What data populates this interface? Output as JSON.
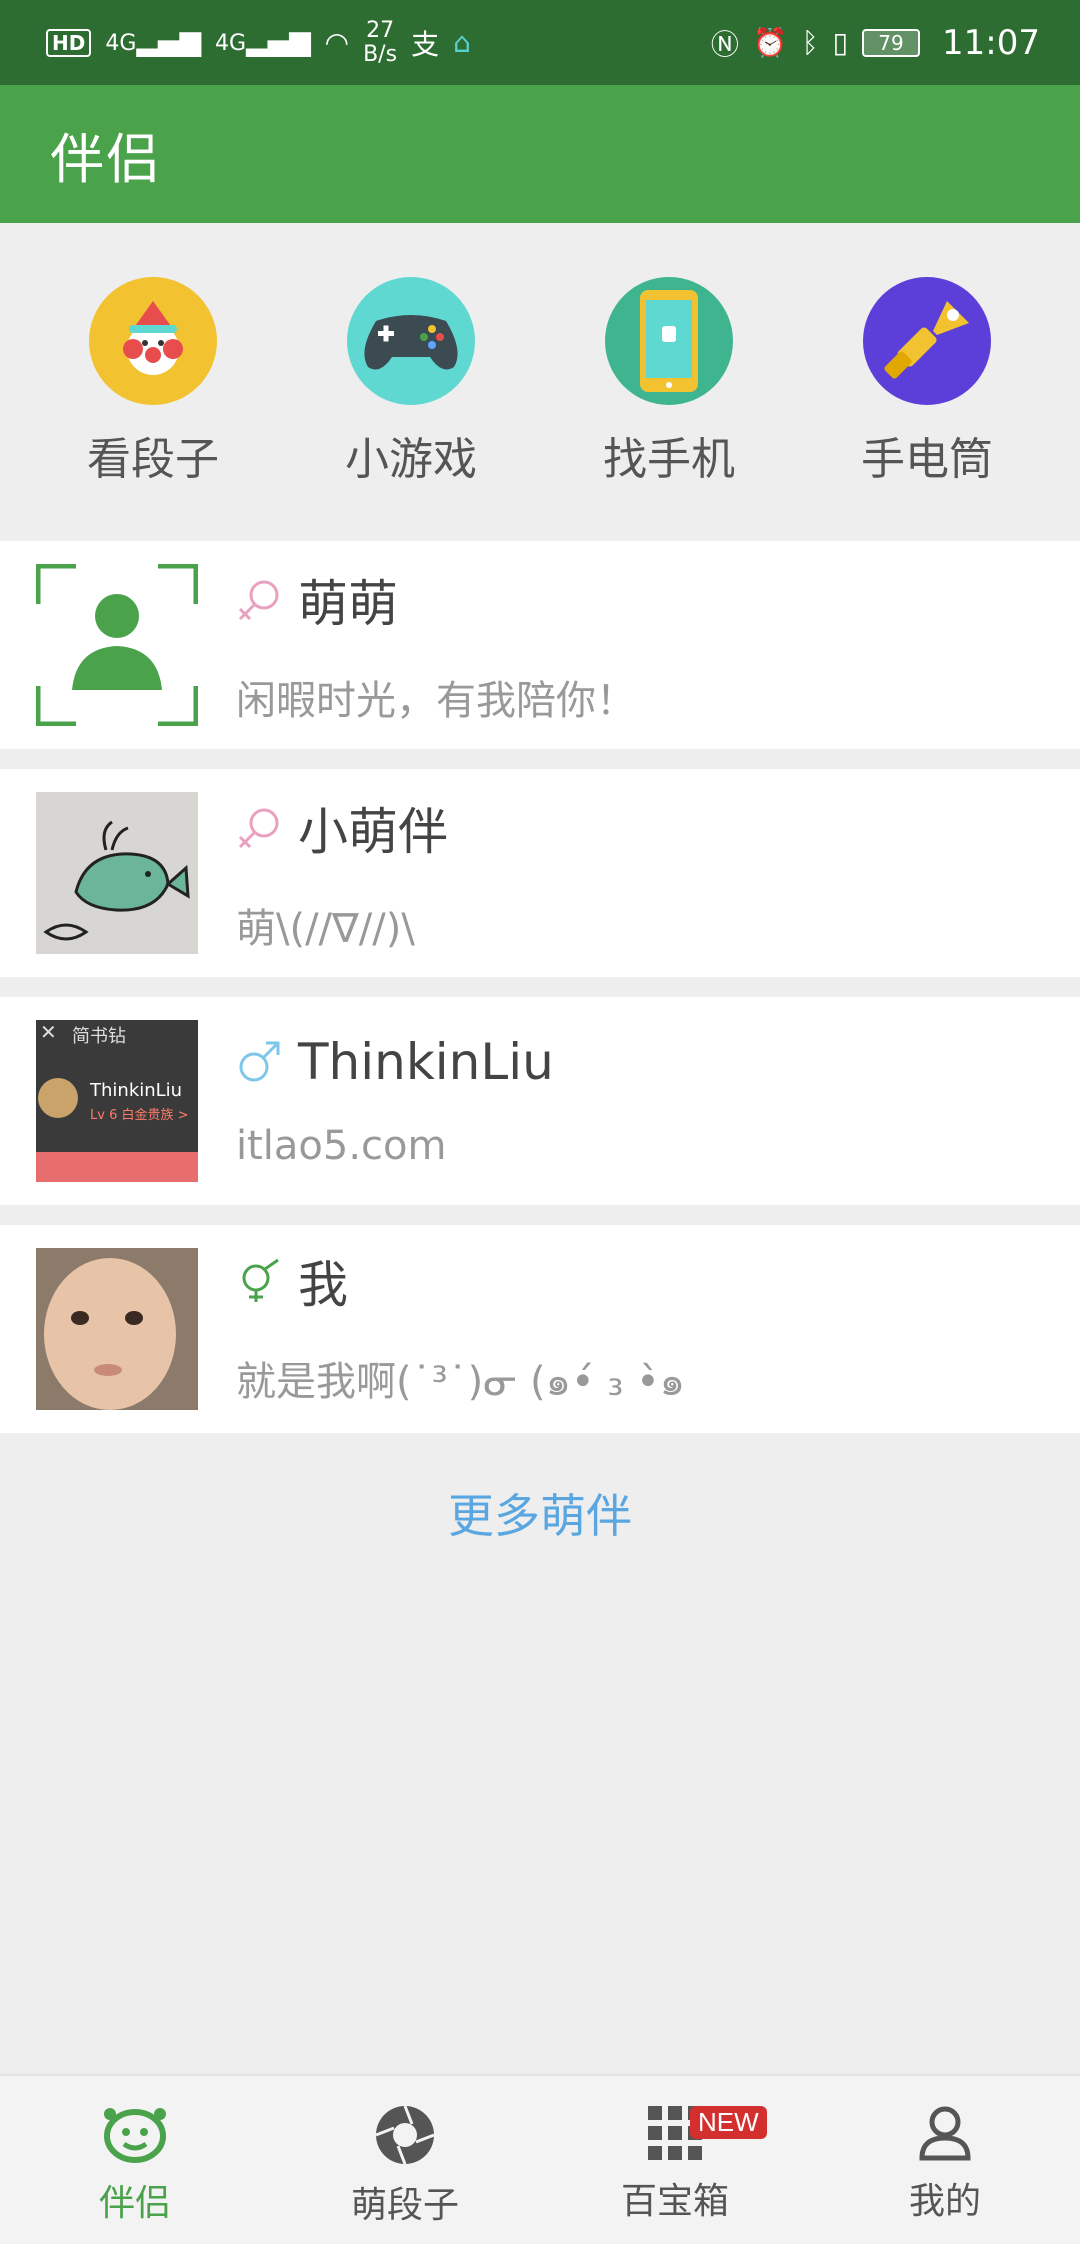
{
  "status_bar": {
    "left": {
      "hd": "HD",
      "net1": "4G",
      "net2": "4G",
      "speed": "27",
      "speed_unit": "B/s"
    },
    "right": {
      "battery": "79",
      "time": "11:07"
    }
  },
  "app_bar": {
    "title": "伴侣"
  },
  "quick_actions": [
    {
      "label": "看段子",
      "icon": "clown-icon",
      "color": "#f2c230"
    },
    {
      "label": "小游戏",
      "icon": "gamepad-icon",
      "color": "#5ed8d0"
    },
    {
      "label": "找手机",
      "icon": "phone-icon",
      "color": "#3fb58f"
    },
    {
      "label": "手电筒",
      "icon": "flashlight-icon",
      "color": "#5b3fd8"
    }
  ],
  "companions": [
    {
      "name": "萌萌",
      "desc": "闲暇时光，有我陪你！",
      "gender": "female",
      "avatar": "placeholder-avatar"
    },
    {
      "name": "小萌伴",
      "desc": "萌\\(//∇//)\\",
      "gender": "female",
      "avatar": "whale-drawing"
    },
    {
      "name": "ThinkinLiu",
      "desc": "itlao5.com",
      "gender": "male",
      "avatar": "profile-screenshot",
      "avatar_text": {
        "title": "简书钻",
        "name": "ThinkinLiu",
        "level": "Lv 6 白金贵族 >"
      }
    },
    {
      "name": "我",
      "desc": "就是我啊(˙³˙)ᓂ (๑•́ ₃ •̀๑",
      "gender": "other",
      "avatar": "baby-photo"
    }
  ],
  "more_link": "更多萌伴",
  "bottom_nav": [
    {
      "label": "伴侣",
      "icon": "smiley-icon",
      "active": true
    },
    {
      "label": "萌段子",
      "icon": "camera-shutter-icon",
      "active": false
    },
    {
      "label": "百宝箱",
      "icon": "grid-icon",
      "active": false,
      "badge": "NEW"
    },
    {
      "label": "我的",
      "icon": "person-icon",
      "active": false
    }
  ],
  "colors": {
    "primary": "#4aa24b",
    "status_bar": "#2e6d32",
    "link": "#5aa6e0",
    "female": "#e9a1bf",
    "male": "#7ec7ea"
  }
}
